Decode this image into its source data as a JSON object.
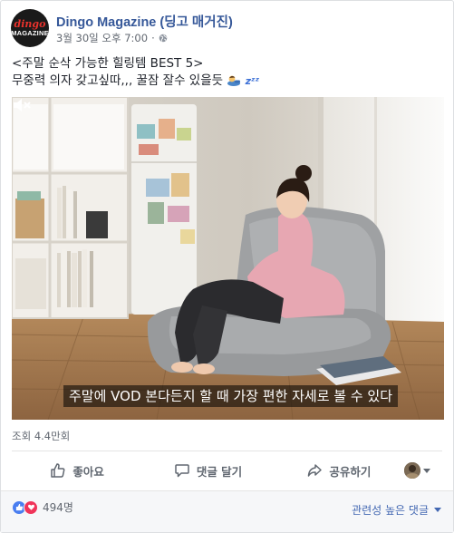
{
  "post": {
    "page_name": "Dingo Magazine (딩고 매거진)",
    "avatar_text": [
      "dingo",
      "MAGAZINE"
    ],
    "timestamp": "3월 30일 오후 7:00",
    "separator": "·",
    "privacy_icon": "globe-icon",
    "text_line1": "<주말 순삭 가능한 힐링템 BEST 5>",
    "text_line2": "무중력 의자 갖고싶따,,, 꿀잠 잘수 있을듯",
    "text_emoji_zzz": "zᶻᶻ"
  },
  "video": {
    "subtitle": "주말에 VOD 본다든지 할 때 가장 편한 자세로 볼 수 있다",
    "mute_icon": "speaker-muted-icon"
  },
  "stats": {
    "views": "조회 4.4만회",
    "reaction_count": "494명"
  },
  "actions": {
    "like": "좋아요",
    "comment": "댓글 달기",
    "share": "공유하기"
  },
  "footer": {
    "sort_label": "관련성 높은 댓글"
  },
  "colors": {
    "link_blue": "#365899",
    "like_blue": "#4a7ef0",
    "love_red": "#f0345a",
    "meta_gray": "#616770"
  }
}
